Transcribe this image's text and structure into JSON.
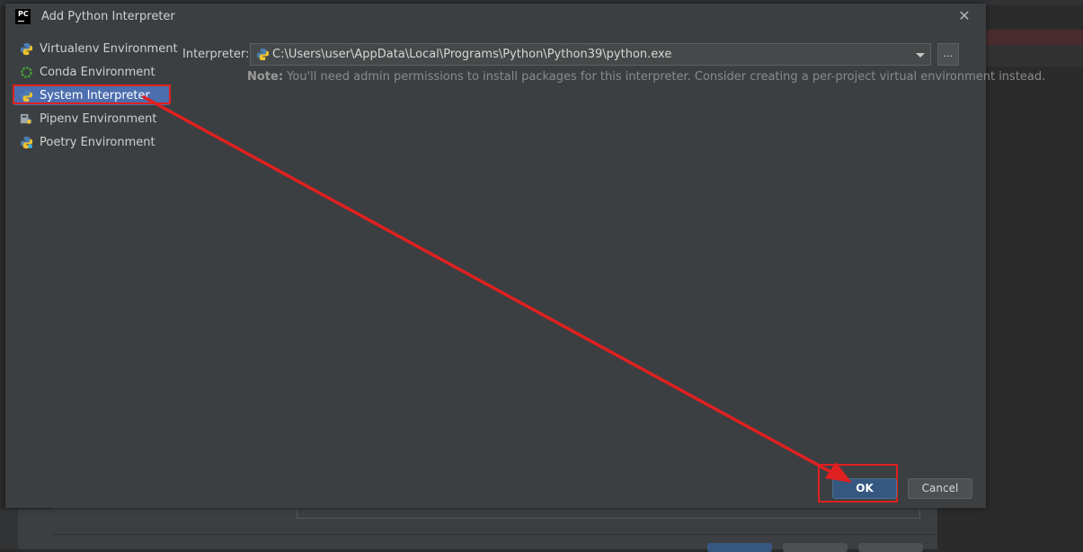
{
  "dialog": {
    "app_icon_text": "PC",
    "title": "Add Python Interpreter",
    "close_symbol": "✕"
  },
  "sidebar": {
    "items": [
      {
        "label": "Virtualenv Environment",
        "icon": "python-icon"
      },
      {
        "label": "Conda Environment",
        "icon": "conda-icon"
      },
      {
        "label": "System Interpreter",
        "icon": "python-icon",
        "selected": true
      },
      {
        "label": "Pipenv Environment",
        "icon": "pipenv-icon"
      },
      {
        "label": "Poetry Environment",
        "icon": "poetry-icon"
      }
    ]
  },
  "interpreter": {
    "label": "Interpreter:",
    "value": "C:\\Users\\user\\AppData\\Local\\Programs\\Python\\Python39\\python.exe",
    "browse_label": "...",
    "note_bold": "Note:",
    "note_text": " You'll need admin permissions to install packages for this interpreter. Consider creating a per-project virtual environment instead."
  },
  "buttons": {
    "ok": "OK",
    "cancel": "Cancel"
  },
  "colors": {
    "dialog_bg": "#3c3f41",
    "selection": "#4b6eaf",
    "ok_button": "#365880",
    "annotation_red": "#e02020"
  }
}
